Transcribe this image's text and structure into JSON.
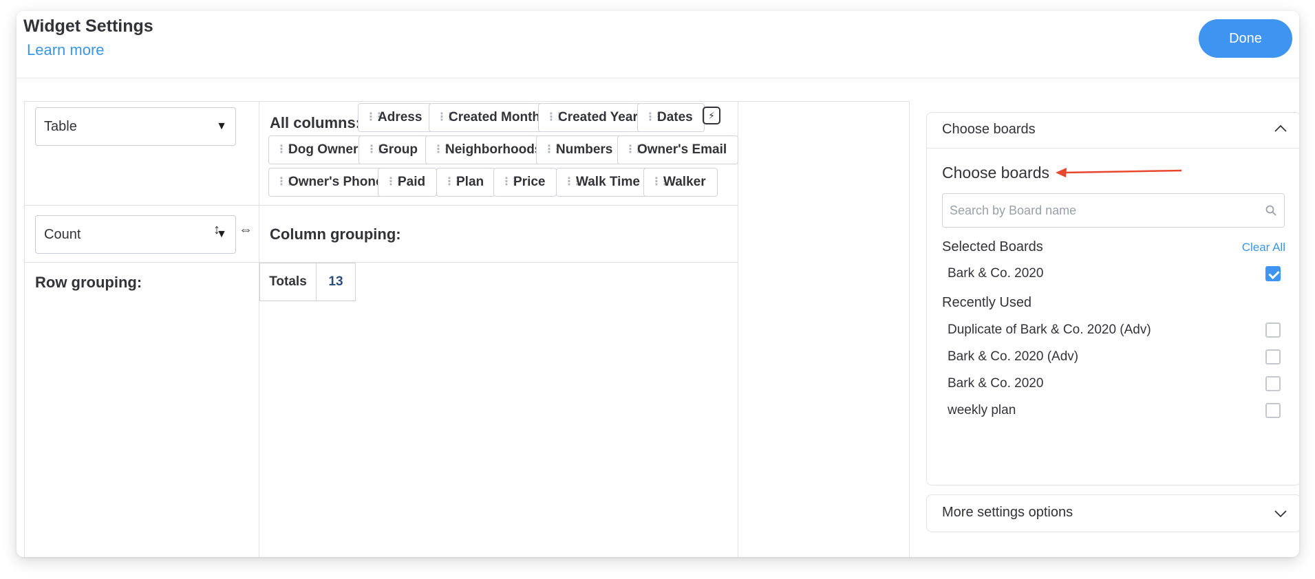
{
  "header": {
    "title": "Widget Settings",
    "learn_more": "Learn more",
    "done_label": "Done"
  },
  "left": {
    "view_select": "Table",
    "function_select": "Count",
    "row_grouping_label": "Row grouping:"
  },
  "center": {
    "all_columns_label": "All columns:",
    "columns": [
      "Adress",
      "Created Month",
      "Created Year",
      "Dates",
      "Dog Owner",
      "Group",
      "Neighborhoods",
      "Numbers",
      "Owner's Email",
      "Owner's Phone",
      "Paid",
      "Plan",
      "Price",
      "Walk Time",
      "Walker"
    ],
    "column_grouping_label": "Column grouping:",
    "totals_label": "Totals",
    "totals_value": "13"
  },
  "boards_panel": {
    "header_label": "Choose boards",
    "heading": "Choose boards",
    "search_placeholder": "Search by Board name",
    "selected_label": "Selected Boards",
    "clear_all": "Clear All",
    "selected": [
      {
        "name": "Bark & Co. 2020",
        "checked": true
      }
    ],
    "recent_label": "Recently Used",
    "recent": [
      {
        "name": "Duplicate of Bark & Co. 2020 (Adv)",
        "checked": false
      },
      {
        "name": "Bark & Co. 2020 (Adv)",
        "checked": false
      },
      {
        "name": "Bark & Co. 2020",
        "checked": false
      },
      {
        "name": "weekly plan",
        "checked": false
      }
    ]
  },
  "more_settings": {
    "label": "More settings options"
  },
  "colors": {
    "accent": "#3e94f0",
    "link": "#3a96e6",
    "annotation_arrow": "#e8472e"
  },
  "icons": {
    "view_caret": "caret-down-icon",
    "function_caret": "caret-down-icon",
    "vertical": "resize-vertical-icon",
    "horizontal": "resize-horizontal-icon",
    "bolt": "lightning-bolt-icon",
    "collapse": "chevron-up-icon",
    "expand": "chevron-down-icon",
    "search": "search-icon"
  }
}
